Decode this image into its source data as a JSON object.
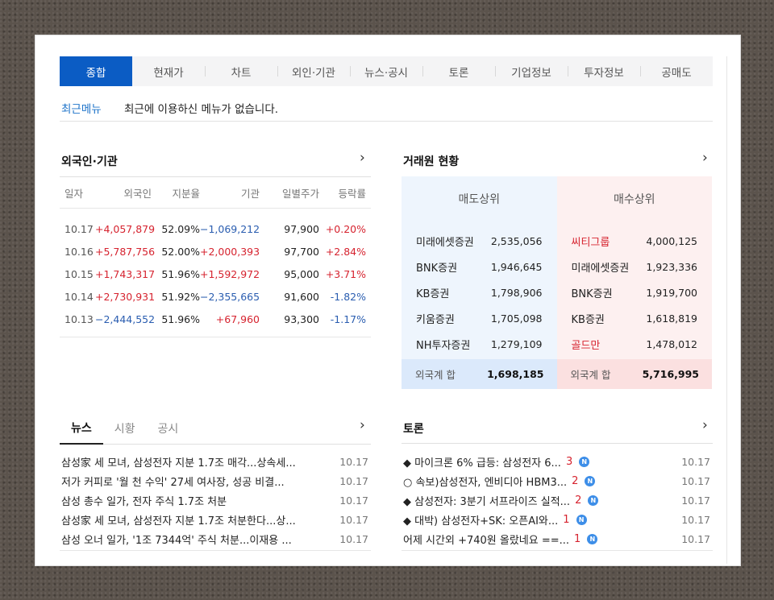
{
  "tabs": [
    "종합",
    "현재가",
    "차트",
    "외인·기관",
    "뉴스·공시",
    "토론",
    "기업정보",
    "투자정보",
    "공매도"
  ],
  "recent": {
    "label": "최근메뉴",
    "text": "최근에 이용하신 메뉴가 없습니다."
  },
  "foreign": {
    "title": "외국인·기관",
    "headers": [
      "일자",
      "외국인",
      "지분율",
      "기관",
      "일별주가",
      "등락률"
    ],
    "rows": [
      [
        "10.17",
        "+4,057,879",
        "52.09%",
        "−1,069,212",
        "97,900",
        "+0.20%"
      ],
      [
        "10.16",
        "+5,787,756",
        "52.00%",
        "+2,000,393",
        "97,700",
        "+2.84%"
      ],
      [
        "10.15",
        "+1,743,317",
        "51.96%",
        "+1,592,972",
        "95,000",
        "+3.71%"
      ],
      [
        "10.14",
        "+2,730,931",
        "51.92%",
        "−2,355,665",
        "91,600",
        "-1.82%"
      ],
      [
        "10.13",
        "−2,444,552",
        "51.96%",
        "+67,960",
        "93,300",
        "-1.17%"
      ]
    ]
  },
  "broker": {
    "title": "거래원 현황",
    "sell": {
      "header": "매도상위",
      "items": [
        {
          "name": "미래에셋증권",
          "value": "2,535,056"
        },
        {
          "name": "BNK증권",
          "value": "1,946,645"
        },
        {
          "name": "KB증권",
          "value": "1,798,906"
        },
        {
          "name": "키움증권",
          "value": "1,705,098"
        },
        {
          "name": "NH투자증권",
          "value": "1,279,109"
        }
      ],
      "sum_label": "외국계 합",
      "sum_value": "1,698,185"
    },
    "buy": {
      "header": "매수상위",
      "items": [
        {
          "name": "씨티그룹",
          "value": "4,000,125"
        },
        {
          "name": "미래에셋증권",
          "value": "1,923,336"
        },
        {
          "name": "BNK증권",
          "value": "1,919,700"
        },
        {
          "name": "KB증권",
          "value": "1,618,819"
        },
        {
          "name": "골드만",
          "value": "1,478,012"
        }
      ],
      "sum_label": "외국계 합",
      "sum_value": "5,716,995"
    }
  },
  "news": {
    "tabs": [
      "뉴스",
      "시황",
      "공시"
    ],
    "items": [
      {
        "title": "삼성家 세 모녀, 삼성전자 지분 1.7조 매각...상속세...",
        "date": "10.17"
      },
      {
        "title": "저가 커피로 '월 천 수익' 27세 여사장, 성공 비결...",
        "date": "10.17"
      },
      {
        "title": "삼성 총수 일가, 전자 주식 1.7조 처분",
        "date": "10.17"
      },
      {
        "title": "삼성家 세 모녀, 삼성전자 지분 1.7조 처분한다...상...",
        "date": "10.17"
      },
      {
        "title": "삼성 오너 일가, '1조 7344억' 주식 처분...이재용 ...",
        "date": "10.17"
      }
    ]
  },
  "discussion": {
    "title": "토론",
    "badge": "N",
    "items": [
      {
        "title": "◆ 마이크론 6% 급등: 삼성전자 6...",
        "count": "3",
        "date": "10.17"
      },
      {
        "title": "○ 속보)삼성전자, 엔비디아 HBM3...",
        "count": "2",
        "date": "10.17"
      },
      {
        "title": "◆ 삼성전자: 3분기 서프라이즈 실적...",
        "count": "2",
        "date": "10.17"
      },
      {
        "title": "◆ 대박) 삼성전자+SK: 오픈AI와...",
        "count": "1",
        "date": "10.17"
      },
      {
        "title": "어제 시간외 +740원 올랐네요 ==...",
        "count": "1",
        "date": "10.17"
      }
    ]
  },
  "colors": {
    "accent": "#0b5cc4",
    "up": "#d6232f",
    "down": "#2a5db0",
    "sell_bg": "#eef5fd",
    "buy_bg": "#fdf0f0"
  },
  "chevron": "›"
}
